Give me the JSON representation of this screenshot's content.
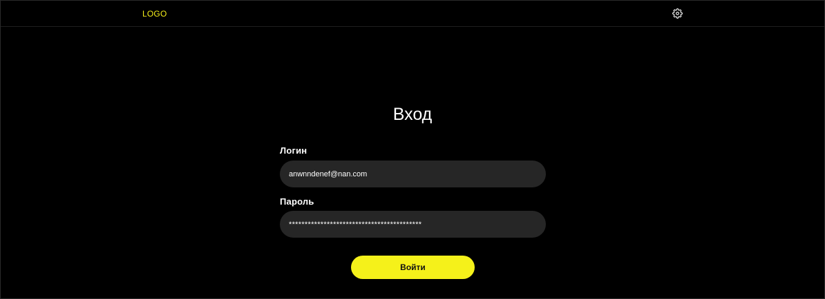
{
  "header": {
    "logo": "LOGO",
    "settings_icon": "gear-icon"
  },
  "login_form": {
    "title": "Вход",
    "login_label": "Логин",
    "login_value": "anwnndenef@nan.com",
    "password_label": "Пароль",
    "password_value": "******************************************",
    "submit_label": "Войти"
  },
  "colors": {
    "background": "#000000",
    "accent": "#f5f11a",
    "field_background": "#262626",
    "text": "#ffffff"
  }
}
